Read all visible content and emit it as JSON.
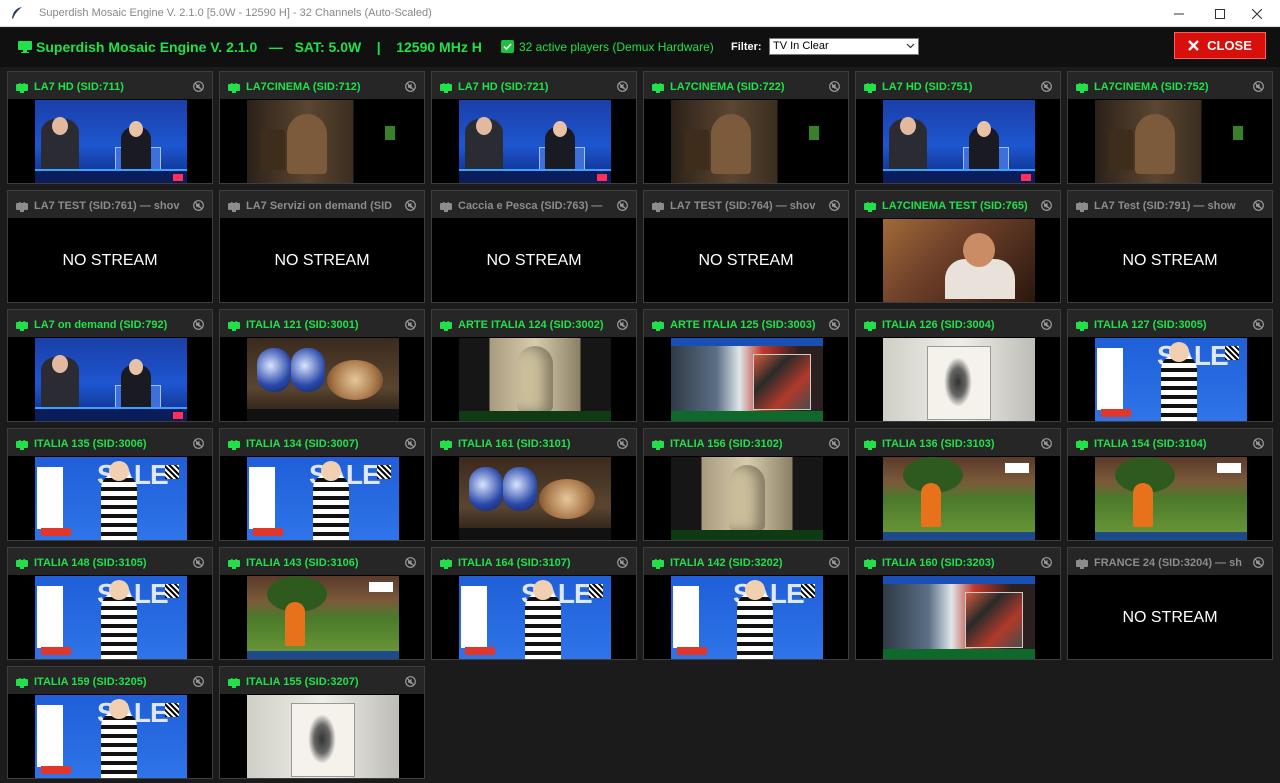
{
  "window": {
    "title": "Superdish Mosaic Engine V. 2.1.0 [5.0W - 12590 H] - 32 Channels (Auto-Scaled)"
  },
  "header": {
    "title": "Superdish Mosaic Engine V. 2.1.0   —   SAT: 5.0W    |    12590 MHz H",
    "checkbox_label": "32 active players (Demux Hardware)",
    "checkbox_checked": true,
    "filter_label": "Filter:",
    "filter_value": "TV In Clear",
    "close_label": "CLOSE"
  },
  "colors": {
    "active_green": "#22e04a",
    "inactive_gray": "#8c8c8c",
    "close_red": "#d7100c",
    "background": "#1b1b1b"
  },
  "no_stream_text": "NO STREAM",
  "channels": [
    {
      "label": "LA7 HD (SID:711)",
      "status": "on",
      "scene": "news"
    },
    {
      "label": "LA7CINEMA (SID:712)",
      "status": "on",
      "scene": "cinema"
    },
    {
      "label": "LA7 HD (SID:721)",
      "status": "on",
      "scene": "news"
    },
    {
      "label": "LA7CINEMA (SID:722)",
      "status": "on",
      "scene": "cinema"
    },
    {
      "label": "LA7 HD (SID:751)",
      "status": "on",
      "scene": "news"
    },
    {
      "label": "LA7CINEMA (SID:752)",
      "status": "on",
      "scene": "cinema"
    },
    {
      "label": "LA7 TEST (SID:761) — shov",
      "status": "off",
      "scene": "none"
    },
    {
      "label": "LA7 Servizi on demand (SID",
      "status": "off",
      "scene": "none"
    },
    {
      "label": "Caccia e Pesca (SID:763) —",
      "status": "off",
      "scene": "none"
    },
    {
      "label": "LA7 TEST (SID:764) — shov",
      "status": "off",
      "scene": "none"
    },
    {
      "label": "LA7CINEMA TEST (SID:765)",
      "status": "on",
      "scene": "dark"
    },
    {
      "label": "LA7 Test (SID:791) — show",
      "status": "off",
      "scene": "none"
    },
    {
      "label": "LA7 on demand (SID:792)",
      "status": "on",
      "scene": "news"
    },
    {
      "label": "ITALIA 121 (SID:3001)",
      "status": "on",
      "scene": "pottery"
    },
    {
      "label": "ARTE ITALIA 124 (SID:3002)",
      "status": "on",
      "scene": "statue"
    },
    {
      "label": "ARTE ITALIA 125 (SID:3003)",
      "status": "on",
      "scene": "art"
    },
    {
      "label": "ITALIA 126 (SID:3004)",
      "status": "on",
      "scene": "sketch"
    },
    {
      "label": "ITALIA 127 (SID:3005)",
      "status": "on",
      "scene": "sale"
    },
    {
      "label": "ITALIA 135 (SID:3006)",
      "status": "on",
      "scene": "sale"
    },
    {
      "label": "ITALIA 134 (SID:3007)",
      "status": "on",
      "scene": "sale"
    },
    {
      "label": "ITALIA 161 (SID:3101)",
      "status": "on",
      "scene": "pottery"
    },
    {
      "label": "ITALIA 156 (SID:3102)",
      "status": "on",
      "scene": "statue"
    },
    {
      "label": "ITALIA 136 (SID:3103)",
      "status": "on",
      "scene": "garden"
    },
    {
      "label": "ITALIA 154 (SID:3104)",
      "status": "on",
      "scene": "garden"
    },
    {
      "label": "ITALIA 148 (SID:3105)",
      "status": "on",
      "scene": "sale"
    },
    {
      "label": "ITALIA 143 (SID:3106)",
      "status": "on",
      "scene": "garden"
    },
    {
      "label": "ITALIA 164 (SID:3107)",
      "status": "on",
      "scene": "sale"
    },
    {
      "label": "ITALIA 142 (SID:3202)",
      "status": "on",
      "scene": "sale"
    },
    {
      "label": "ITALIA 160 (SID:3203)",
      "status": "on",
      "scene": "art"
    },
    {
      "label": "FRANCE 24 (SID:3204) — sh",
      "status": "off",
      "scene": "none"
    },
    {
      "label": "ITALIA 159 (SID:3205)",
      "status": "on",
      "scene": "sale"
    },
    {
      "label": "ITALIA 155 (SID:3207)",
      "status": "on",
      "scene": "sketch"
    }
  ]
}
